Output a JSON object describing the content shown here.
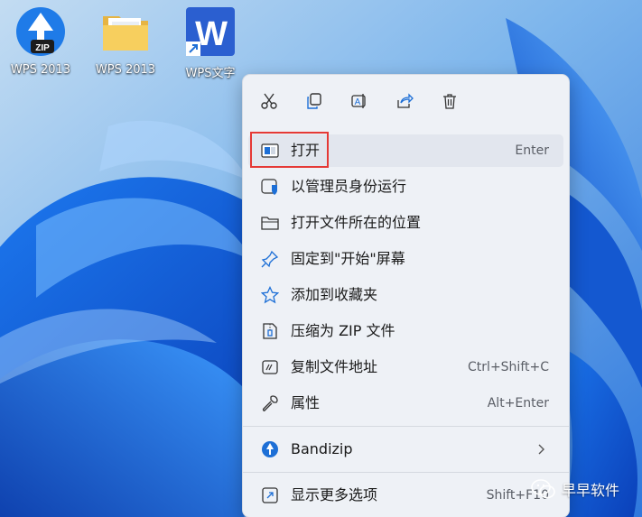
{
  "desktop": {
    "icons": [
      {
        "label": "WPS 2013",
        "icon": "zip-archive-icon"
      },
      {
        "label": "WPS 2013",
        "icon": "folder-icon"
      },
      {
        "label": "WPS文字",
        "icon": "wps-writer-shortcut-icon"
      }
    ]
  },
  "context_menu": {
    "toolbar": [
      {
        "icon": "cut-icon"
      },
      {
        "icon": "copy-icon"
      },
      {
        "icon": "rename-icon"
      },
      {
        "icon": "share-icon"
      },
      {
        "icon": "delete-icon"
      }
    ],
    "items": [
      {
        "label": "打开",
        "shortcut": "Enter",
        "icon": "open-window-icon"
      },
      {
        "label": "以管理员身份运行",
        "shortcut": "",
        "icon": "shield-icon"
      },
      {
        "label": "打开文件所在的位置",
        "shortcut": "",
        "icon": "folder-outline-icon"
      },
      {
        "label": "固定到\"开始\"屏幕",
        "shortcut": "",
        "icon": "pin-icon"
      },
      {
        "label": "添加到收藏夹",
        "shortcut": "",
        "icon": "star-icon"
      },
      {
        "label": "压缩为 ZIP 文件",
        "shortcut": "",
        "icon": "zip-file-icon"
      },
      {
        "label": "复制文件地址",
        "shortcut": "Ctrl+Shift+C",
        "icon": "copy-path-icon"
      },
      {
        "label": "属性",
        "shortcut": "Alt+Enter",
        "icon": "wrench-icon"
      },
      {
        "label": "Bandizip",
        "shortcut": "",
        "icon": "bandizip-icon",
        "submenu": true
      },
      {
        "label": "显示更多选项",
        "shortcut": "Shift+F10",
        "icon": "more-options-icon"
      }
    ]
  },
  "watermark": {
    "text": "早早软件",
    "icon": "wechat-icon"
  },
  "colors": {
    "highlight": "#e53935",
    "accent": "#1d6fd6",
    "menu_bg": "#eef1f6"
  }
}
